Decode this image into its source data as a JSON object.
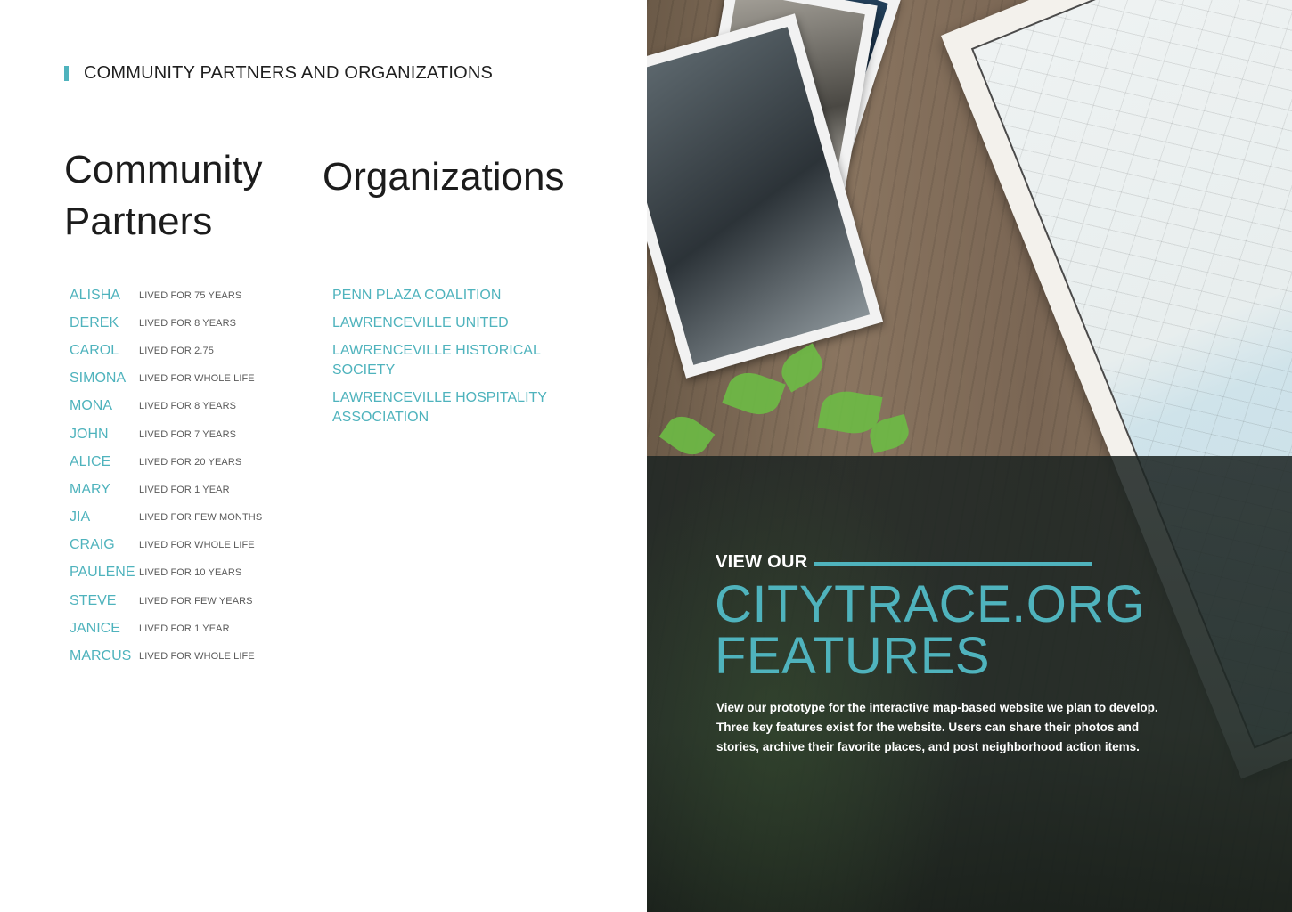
{
  "header": {
    "title": "COMMUNITY PARTNERS AND ORGANIZATIONS"
  },
  "headings": {
    "community": "Community Partners",
    "organizations": "Organizations"
  },
  "partners": [
    {
      "name": "ALISHA",
      "lived": "LIVED FOR 75 YEARS"
    },
    {
      "name": "DEREK",
      "lived": "LIVED FOR 8 YEARS"
    },
    {
      "name": "CAROL",
      "lived": "LIVED FOR 2.75"
    },
    {
      "name": "SIMONA",
      "lived": "LIVED FOR WHOLE LIFE"
    },
    {
      "name": "MONA",
      "lived": "LIVED FOR 8 YEARS"
    },
    {
      "name": "JOHN",
      "lived": "LIVED FOR 7 YEARS"
    },
    {
      "name": "ALICE",
      "lived": "LIVED FOR 20 YEARS"
    },
    {
      "name": "MARY",
      "lived": "LIVED FOR 1 YEAR"
    },
    {
      "name": "JIA",
      "lived": "LIVED FOR FEW MONTHS"
    },
    {
      "name": "CRAIG",
      "lived": "LIVED FOR WHOLE LIFE"
    },
    {
      "name": "PAULENE",
      "lived": "LIVED FOR 10 YEARS"
    },
    {
      "name": "STEVE",
      "lived": "LIVED FOR FEW YEARS"
    },
    {
      "name": "JANICE",
      "lived": "LIVED FOR 1 YEAR"
    },
    {
      "name": "MARCUS",
      "lived": "LIVED FOR WHOLE LIFE"
    }
  ],
  "organizations": [
    "PENN PLAZA COALITION",
    "LAWRENCEVILLE UNITED",
    "LAWRENCEVILLE HISTORICAL SOCIETY",
    "LAWRENCEVILLE HOSPITALITY ASSOCIATION"
  ],
  "promo": {
    "kicker": "VIEW OUR",
    "title_line1": "CITYTRACE.ORG",
    "title_line2": "FEATURES",
    "description": "View our prototype for the interactive map-based website we plan to develop. Three key features exist for the website. Users can share their photos and stories, archive their favorite places, and post neighborhood action items."
  },
  "colors": {
    "accent": "#4fb3bd",
    "heading": "#1c1c1c"
  }
}
